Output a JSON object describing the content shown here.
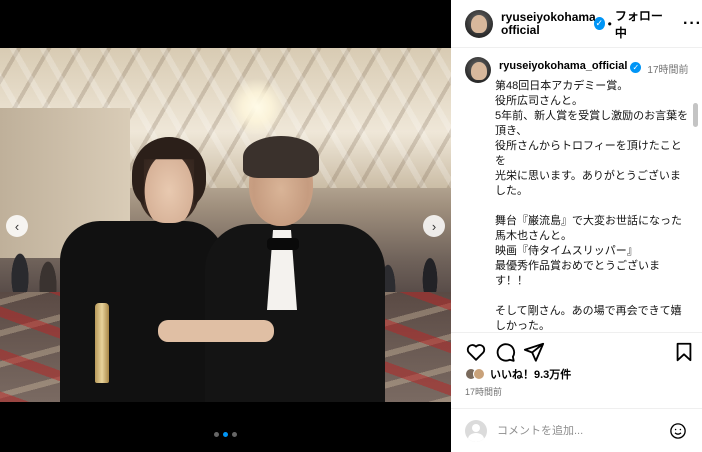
{
  "account": {
    "handle": "ryuseiyokohama_\nofficial",
    "handle_full": "ryuseiyokohama_official",
    "verified": true,
    "follow_status": "フォロー中",
    "more_label": "···"
  },
  "post": {
    "caption_time": "17時間前",
    "caption": "第48回日本アカデミー賞。\n役所広司さんと。\n5年前、新人賞を受賞し激励のお言葉を頂き、\n役所さんからトロフィーを頂けたことを\n光栄に思います。ありがとうございました。\n\n舞台『巌流島』で大変お世話になった\n馬木也さんと。\n映画『侍タイムスリッパー』\n最優秀作品賞おめでとうございます！！\n\nそして剛さん。あの場で再会できて嬉しかった。\n引き続き宜しくお願いします！！",
    "likes": "いいね！9.3万件",
    "time": "17時間前"
  },
  "media": {
    "carousel_count": 3,
    "carousel_active": 1,
    "prev_label": "‹",
    "next_label": "›"
  },
  "comment": {
    "placeholder": "コメントを追加..."
  },
  "icons": {
    "like": "heart-icon",
    "comment": "comment-icon",
    "share": "share-icon",
    "save": "bookmark-icon",
    "emoji": "emoji-icon"
  },
  "colors": {
    "verified": "#0095f6",
    "muted": "#737373",
    "border": "#efefef"
  }
}
